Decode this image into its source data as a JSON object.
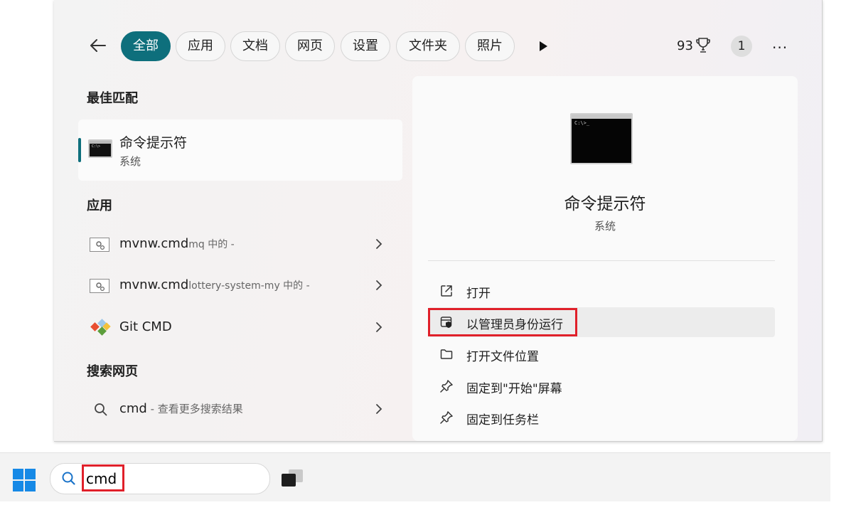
{
  "header": {
    "tabs": [
      {
        "label": "全部",
        "active": true
      },
      {
        "label": "应用"
      },
      {
        "label": "文档"
      },
      {
        "label": "网页"
      },
      {
        "label": "设置"
      },
      {
        "label": "文件夹"
      },
      {
        "label": "照片"
      }
    ],
    "points": "93",
    "avatar": "1",
    "more": "···"
  },
  "best_match": {
    "section_title": "最佳匹配",
    "name": "命令提示符",
    "subtitle": "系统"
  },
  "apps": {
    "section_title": "应用",
    "items": [
      {
        "name": "mvnw.cmd",
        "meta": "mq 中的 -"
      },
      {
        "name": "mvnw.cmd",
        "meta": "lottery-system-my 中的 -"
      },
      {
        "name": "Git CMD",
        "meta": ""
      }
    ]
  },
  "web": {
    "section_title": "搜索网页",
    "query": "cmd",
    "meta": " - 查看更多搜索结果"
  },
  "detail": {
    "title": "命令提示符",
    "subtitle": "系统",
    "actions": [
      {
        "label": "打开",
        "icon": "open-external-icon"
      },
      {
        "label": "以管理员身份运行",
        "icon": "admin-shield-icon",
        "highlighted": true
      },
      {
        "label": "打开文件位置",
        "icon": "folder-icon"
      },
      {
        "label": "固定到\"开始\"屏幕",
        "icon": "pin-icon"
      },
      {
        "label": "固定到任务栏",
        "icon": "pin-icon"
      }
    ]
  },
  "taskbar": {
    "search_value": "cmd"
  },
  "colors": {
    "accent": "#0e6f7c",
    "annotation_red": "#e0202a",
    "windows_blue": "#1689e6"
  }
}
